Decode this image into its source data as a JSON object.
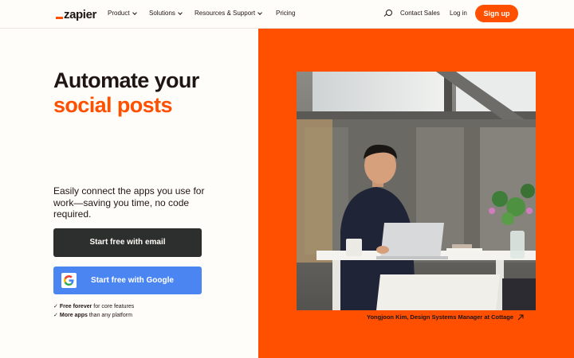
{
  "nav": {
    "logo": "zapier",
    "items": [
      {
        "label": "Product",
        "dropdown": true
      },
      {
        "label": "Solutions",
        "dropdown": true
      },
      {
        "label": "Resources & Support",
        "dropdown": true
      },
      {
        "label": "Pricing",
        "dropdown": false
      }
    ],
    "search_icon": "search-icon",
    "contact_sales": "Contact Sales",
    "login": "Log in",
    "signup": "Sign up"
  },
  "hero": {
    "headline_line1": "Automate your",
    "headline_line2": "social posts",
    "description": "Easily connect the apps you use for work—saving you time, no code required.",
    "btn_email": "Start free with email",
    "btn_google": "Start free with Google",
    "features": [
      {
        "bold": "Free forever",
        "rest": " for core features"
      },
      {
        "bold": "More apps",
        "rest": " than any platform"
      }
    ],
    "photo_caption": "Yongjoon Kim, Design Systems Manager at Cottage"
  },
  "colors": {
    "brand_orange": "#ff4f00",
    "background": "#fffdf9",
    "dark_button": "#2d2e2e",
    "google_blue": "#4a85f2",
    "text": "#201515"
  }
}
